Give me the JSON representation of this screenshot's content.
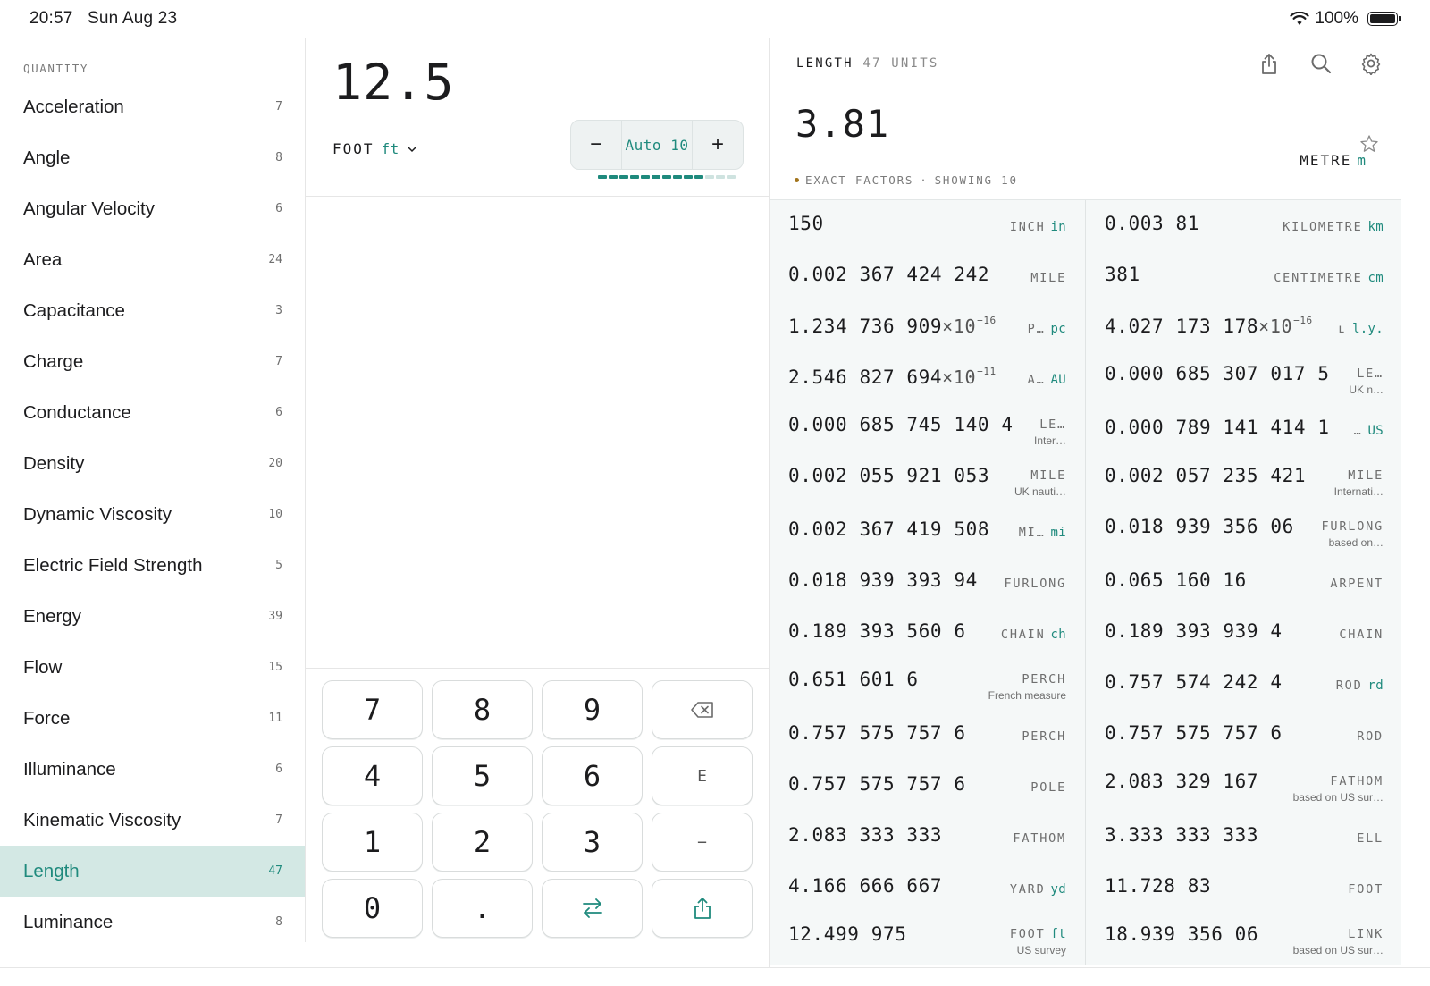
{
  "status": {
    "time": "20:57",
    "date": "Sun Aug 23",
    "battery": "100%"
  },
  "sidebar": {
    "header": "QUANTITY",
    "items": [
      {
        "label": "Acceleration",
        "count": "7"
      },
      {
        "label": "Angle",
        "count": "8"
      },
      {
        "label": "Angular Velocity",
        "count": "6"
      },
      {
        "label": "Area",
        "count": "24"
      },
      {
        "label": "Capacitance",
        "count": "3"
      },
      {
        "label": "Charge",
        "count": "7"
      },
      {
        "label": "Conductance",
        "count": "6"
      },
      {
        "label": "Density",
        "count": "20"
      },
      {
        "label": "Dynamic Viscosity",
        "count": "10"
      },
      {
        "label": "Electric Field Strength",
        "count": "5"
      },
      {
        "label": "Energy",
        "count": "39"
      },
      {
        "label": "Flow",
        "count": "15"
      },
      {
        "label": "Force",
        "count": "11"
      },
      {
        "label": "Illuminance",
        "count": "6"
      },
      {
        "label": "Kinematic Viscosity",
        "count": "7"
      },
      {
        "label": "Length",
        "count": "47",
        "active": true
      },
      {
        "label": "Luminance",
        "count": "8"
      }
    ]
  },
  "input": {
    "value": "12.5",
    "unit_name": "FOOT",
    "unit_abbr": "ft",
    "precision_label": "Auto 10",
    "minus": "−",
    "plus": "+",
    "precision_level": 10,
    "precision_max": 13
  },
  "keypad": {
    "keys": [
      "7",
      "8",
      "9",
      "backspace",
      "4",
      "5",
      "6",
      "E",
      "1",
      "2",
      "3",
      "−",
      "0",
      ".",
      "swap",
      "share"
    ]
  },
  "result": {
    "quantity": "LENGTH",
    "count_label": "47 UNITS",
    "value": "3.81",
    "unit_name": "METRE",
    "unit_abbr": "m",
    "factors_label": "EXACT FACTORS",
    "showing_label": "SHOWING 10"
  },
  "conversions": [
    [
      {
        "value": "150",
        "unit": "INCH",
        "abbr": "in"
      },
      {
        "value": "0.003 81",
        "unit": "KILOMETRE",
        "abbr": "km"
      }
    ],
    [
      {
        "value": "0.002 367 424 242",
        "unit": "MILE",
        "abbr": ""
      },
      {
        "value": "381",
        "unit": "CENTIMETRE",
        "abbr": "cm"
      }
    ],
    [
      {
        "value": "1.234 736 909",
        "exp": "×10",
        "pow": "−16",
        "unit": "P…",
        "abbr": "pc"
      },
      {
        "value": "4.027 173 178",
        "exp": "×10",
        "pow": "−16",
        "unit": "ʟ",
        "abbr": "l.y."
      }
    ],
    [
      {
        "value": "2.546 827 694",
        "exp": "×10",
        "pow": "−11",
        "unit": "A…",
        "abbr": "AU"
      },
      {
        "value": "0.000 685 307 017 5",
        "unit": "LE…",
        "abbr": "",
        "sub": "UK n…"
      }
    ],
    [
      {
        "value": "0.000 685 745 140 4",
        "unit": "LE…",
        "abbr": "",
        "sub": "Inter…"
      },
      {
        "value": "0.000 789 141 414 1",
        "unit": "…",
        "abbr": "US"
      }
    ],
    [
      {
        "value": "0.002 055 921 053",
        "unit": "MILE",
        "abbr": "",
        "sub": "UK nauti…"
      },
      {
        "value": "0.002 057 235 421",
        "unit": "MILE",
        "abbr": "",
        "sub": "Internati…"
      }
    ],
    [
      {
        "value": "0.002 367 419 508",
        "unit": "MI…",
        "abbr": "mi"
      },
      {
        "value": "0.018 939 356 06",
        "unit": "FURLONG",
        "abbr": "",
        "sub": "based on…"
      }
    ],
    [
      {
        "value": "0.018 939 393 94",
        "unit": "FURLONG",
        "abbr": ""
      },
      {
        "value": "0.065 160 16",
        "unit": "ARPENT",
        "abbr": ""
      }
    ],
    [
      {
        "value": "0.189 393 560 6",
        "unit": "CHAIN",
        "abbr": "ch"
      },
      {
        "value": "0.189 393 939 4",
        "unit": "CHAIN",
        "abbr": ""
      }
    ],
    [
      {
        "value": "0.651 601 6",
        "unit": "PERCH",
        "abbr": "",
        "sub": "French measure"
      },
      {
        "value": "0.757 574 242 4",
        "unit": "ROD",
        "abbr": "rd"
      }
    ],
    [
      {
        "value": "0.757 575 757 6",
        "unit": "PERCH",
        "abbr": ""
      },
      {
        "value": "0.757 575 757 6",
        "unit": "ROD",
        "abbr": ""
      }
    ],
    [
      {
        "value": "0.757 575 757 6",
        "unit": "POLE",
        "abbr": ""
      },
      {
        "value": "2.083 329 167",
        "unit": "FATHOM",
        "abbr": "",
        "sub": "based on US sur…"
      }
    ],
    [
      {
        "value": "2.083 333 333",
        "unit": "FATHOM",
        "abbr": ""
      },
      {
        "value": "3.333 333 333",
        "unit": "ELL",
        "abbr": ""
      }
    ],
    [
      {
        "value": "4.166 666 667",
        "unit": "YARD",
        "abbr": "yd"
      },
      {
        "value": "11.728 83",
        "unit": "FOOT",
        "abbr": ""
      }
    ],
    [
      {
        "value": "12.499 975",
        "unit": "FOOT",
        "abbr": "ft",
        "sub": "US survey"
      },
      {
        "value": "18.939 356 06",
        "unit": "LINK",
        "abbr": "",
        "sub": "based on US sur…"
      }
    ]
  ],
  "colors": {
    "accent": "#1f8a7d",
    "active_bg": "#d3e8e4",
    "factor_dot": "#a2741c"
  }
}
